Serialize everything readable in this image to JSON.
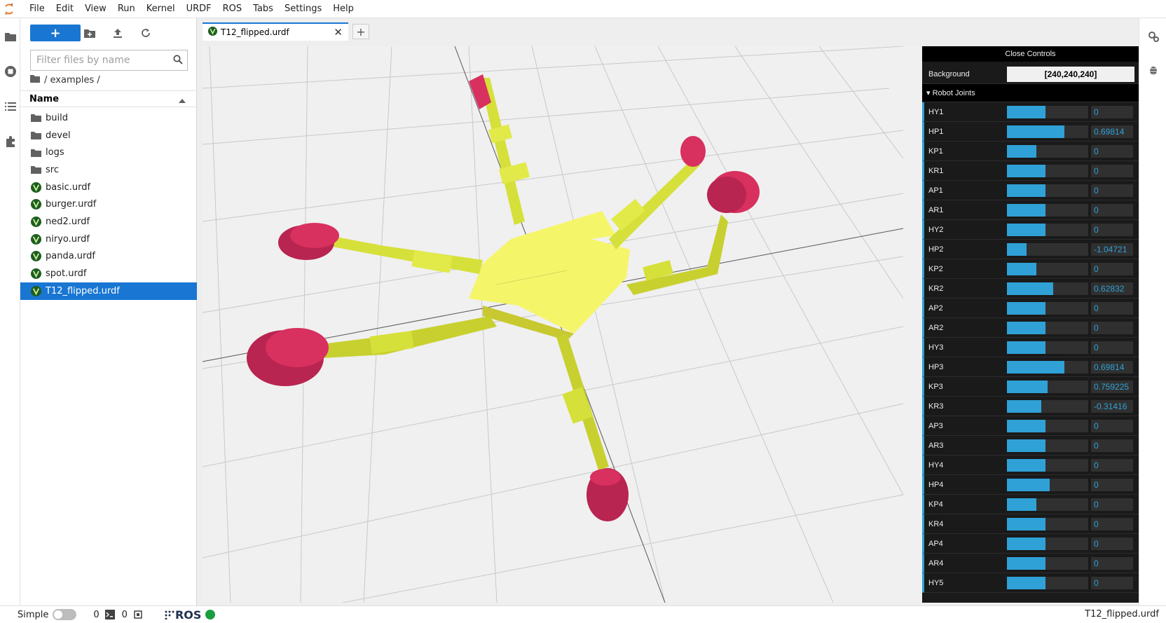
{
  "menubar": {
    "items": [
      "File",
      "Edit",
      "View",
      "Run",
      "Kernel",
      "URDF",
      "ROS",
      "Tabs",
      "Settings",
      "Help"
    ]
  },
  "left_rail": {
    "icons": [
      "folder-icon",
      "running-icon",
      "toc-icon",
      "extension-icon"
    ]
  },
  "file_browser": {
    "new_label": "+",
    "filter_placeholder": "Filter files by name",
    "breadcrumb": "/ examples /",
    "column_name": "Name",
    "files": [
      {
        "name": "build",
        "type": "folder",
        "selected": false
      },
      {
        "name": "devel",
        "type": "folder",
        "selected": false
      },
      {
        "name": "logs",
        "type": "folder",
        "selected": false
      },
      {
        "name": "src",
        "type": "folder",
        "selected": false
      },
      {
        "name": "basic.urdf",
        "type": "urdf",
        "selected": false
      },
      {
        "name": "burger.urdf",
        "type": "urdf",
        "selected": false
      },
      {
        "name": "ned2.urdf",
        "type": "urdf",
        "selected": false
      },
      {
        "name": "niryo.urdf",
        "type": "urdf",
        "selected": false
      },
      {
        "name": "panda.urdf",
        "type": "urdf",
        "selected": false
      },
      {
        "name": "spot.urdf",
        "type": "urdf",
        "selected": false
      },
      {
        "name": "T12_flipped.urdf",
        "type": "urdf",
        "selected": true
      }
    ]
  },
  "tabs": {
    "active": "T12_flipped.urdf",
    "add_label": "+"
  },
  "controls": {
    "close_label": "Close Controls",
    "background_label": "Background",
    "background_value": "[240,240,240]",
    "joints_header": "Robot Joints",
    "joints": [
      {
        "name": "HY1",
        "value": "0",
        "fraction": 0.47
      },
      {
        "name": "HP1",
        "value": "0.69814",
        "fraction": 0.71
      },
      {
        "name": "KP1",
        "value": "0",
        "fraction": 0.36
      },
      {
        "name": "KR1",
        "value": "0",
        "fraction": 0.47
      },
      {
        "name": "AP1",
        "value": "0",
        "fraction": 0.47
      },
      {
        "name": "AR1",
        "value": "0",
        "fraction": 0.47
      },
      {
        "name": "HY2",
        "value": "0",
        "fraction": 0.47
      },
      {
        "name": "HP2",
        "value": "-1.04721",
        "fraction": 0.24
      },
      {
        "name": "KP2",
        "value": "0",
        "fraction": 0.36
      },
      {
        "name": "KR2",
        "value": "0.62832",
        "fraction": 0.57
      },
      {
        "name": "AP2",
        "value": "0",
        "fraction": 0.47
      },
      {
        "name": "AR2",
        "value": "0",
        "fraction": 0.47
      },
      {
        "name": "HY3",
        "value": "0",
        "fraction": 0.47
      },
      {
        "name": "HP3",
        "value": "0.69814",
        "fraction": 0.71
      },
      {
        "name": "KP3",
        "value": "0.759225",
        "fraction": 0.5
      },
      {
        "name": "KR3",
        "value": "-0.31416",
        "fraction": 0.42
      },
      {
        "name": "AP3",
        "value": "0",
        "fraction": 0.47
      },
      {
        "name": "AR3",
        "value": "0",
        "fraction": 0.47
      },
      {
        "name": "HY4",
        "value": "0",
        "fraction": 0.47
      },
      {
        "name": "HP4",
        "value": "0",
        "fraction": 0.53
      },
      {
        "name": "KP4",
        "value": "0",
        "fraction": 0.36
      },
      {
        "name": "KR4",
        "value": "0",
        "fraction": 0.47
      },
      {
        "name": "AP4",
        "value": "0",
        "fraction": 0.47
      },
      {
        "name": "AR4",
        "value": "0",
        "fraction": 0.47
      },
      {
        "name": "HY5",
        "value": "0",
        "fraction": 0.47
      }
    ]
  },
  "right_rail": {
    "icons": [
      "property-inspector-icon",
      "debugger-icon"
    ]
  },
  "statusbar": {
    "mode_label": "Simple",
    "terminals_count": "0",
    "kernels_count": "0",
    "ros_label": "ROS",
    "right_label": "T12_flipped.urdf"
  },
  "colors": {
    "accent": "#1976d2",
    "slider": "#2fa1d6",
    "body": "#f5f56a",
    "legs": "#d6e03a",
    "feet": "#d8305f",
    "ros_status": "#1a9e3f"
  }
}
